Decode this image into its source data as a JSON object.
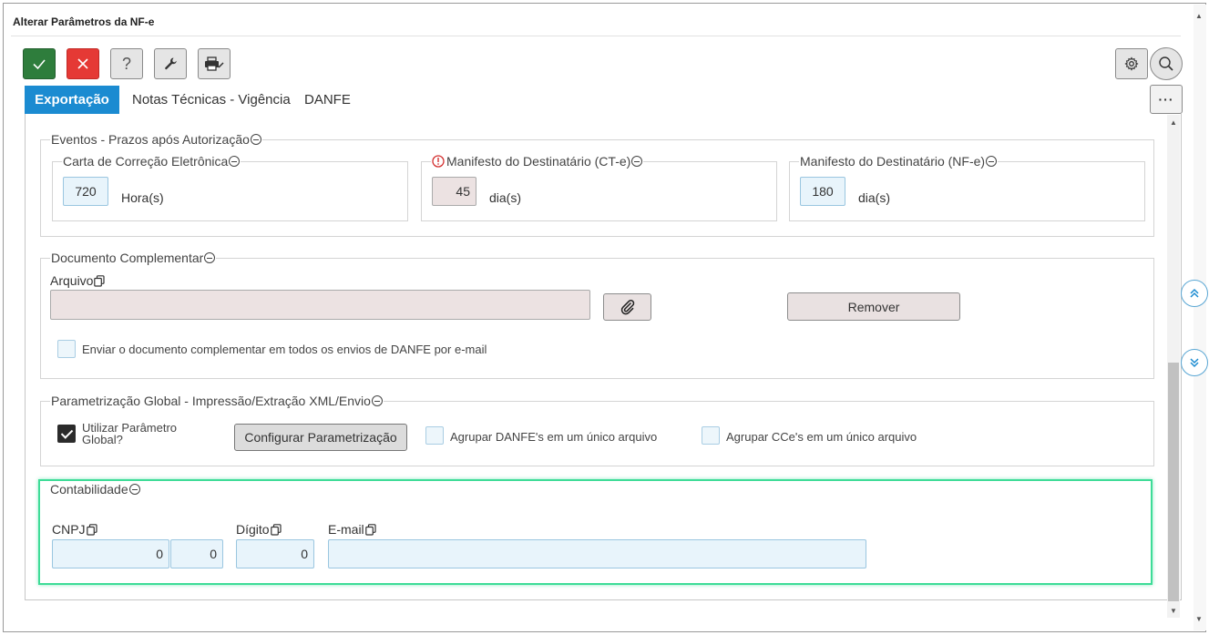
{
  "window": {
    "title": "Alterar Parâmetros da NF-e"
  },
  "toolbar": {
    "confirm_icon": "check-icon",
    "cancel_icon": "close-icon",
    "help_label": "?",
    "tools_icon": "wrench-icon",
    "print_icon": "printer-icon",
    "settings_icon": "gear-icon",
    "search_icon": "search-icon",
    "more_label": "···"
  },
  "tabs": [
    {
      "label": "Exportação",
      "active": true
    },
    {
      "label": "Notas Técnicas - Vigência",
      "active": false
    },
    {
      "label": "DANFE",
      "active": false
    }
  ],
  "eventos": {
    "legend": "Eventos - Prazos após Autorização",
    "carta": {
      "legend": "Carta de Correção Eletrônica",
      "value": "720",
      "unit": "Hora(s)"
    },
    "manifesto_cte": {
      "legend": "Manifesto do Destinatário (CT-e)",
      "value": "45",
      "unit": "dia(s)",
      "alert_icon": "info-alert-icon"
    },
    "manifesto_nfe": {
      "legend": "Manifesto do Destinatário (NF-e)",
      "value": "180",
      "unit": "dia(s)"
    }
  },
  "documento": {
    "legend": "Documento Complementar",
    "arquivo_label": "Arquivo",
    "arquivo_value": "",
    "attach_icon": "paperclip-icon",
    "remove_label": "Remover",
    "checkbox_label": "Enviar o documento complementar em todos os envios de DANFE por e-mail",
    "checkbox_checked": false
  },
  "parametrizacao": {
    "legend": "Parametrização Global - Impressão/Extração XML/Envio",
    "utilizar_label_line1": "Utilizar Parâmetro",
    "utilizar_label_line2": "Global?",
    "utilizar_checked": true,
    "configurar_label": "Configurar Parametrização",
    "agrupar_danfe_label": "Agrupar DANFE's em um único arquivo",
    "agrupar_cce_label": "Agrupar CCe's em um único arquivo"
  },
  "contabilidade": {
    "legend": "Contabilidade",
    "cnpj_label": "CNPJ",
    "cnpj_value": "0",
    "cnpj_value2": "0",
    "digito_label": "Dígito",
    "digito_value": "0",
    "email_label": "E-mail",
    "email_value": ""
  },
  "colors": {
    "accent": "#1b8bd1",
    "confirm": "#2e7d3c",
    "cancel": "#e53935",
    "focus_border": "#3ddc97"
  }
}
